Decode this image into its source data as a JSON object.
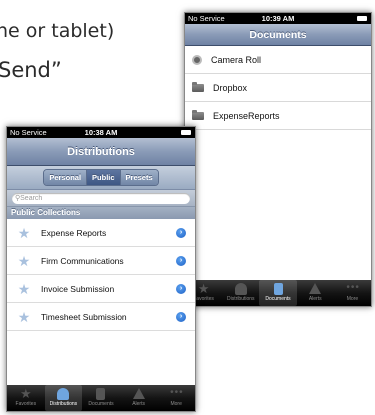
{
  "doc": {
    "line1": "ne or tablet)",
    "line2": "Send”"
  },
  "documents_screen": {
    "status": {
      "carrier": "No Service",
      "time": "10:39 AM"
    },
    "title": "Documents",
    "items": [
      {
        "label": "Camera Roll",
        "icon": "camera-icon"
      },
      {
        "label": "Dropbox",
        "icon": "folder-icon"
      },
      {
        "label": "ExpenseReports",
        "icon": "folder-icon"
      }
    ],
    "tabs": [
      {
        "label": "Favorites",
        "icon": "star-icon"
      },
      {
        "label": "Distributions",
        "icon": "people-icon"
      },
      {
        "label": "Documents",
        "icon": "documents-icon",
        "active": true
      },
      {
        "label": "Alerts",
        "icon": "alert-icon"
      },
      {
        "label": "More",
        "icon": "more-icon"
      }
    ]
  },
  "distributions_screen": {
    "status": {
      "carrier": "No Service",
      "time": "10:38 AM"
    },
    "title": "Distributions",
    "segments": [
      {
        "label": "Personal"
      },
      {
        "label": "Public",
        "active": true
      },
      {
        "label": "Presets"
      }
    ],
    "search_placeholder": "Search",
    "section_header": "Public Collections",
    "items": [
      {
        "label": "Expense Reports"
      },
      {
        "label": "Firm Communications"
      },
      {
        "label": "Invoice Submission"
      },
      {
        "label": "Timesheet Submission"
      }
    ],
    "tabs": [
      {
        "label": "Favorites",
        "icon": "star-icon"
      },
      {
        "label": "Distributions",
        "icon": "people-icon",
        "active": true
      },
      {
        "label": "Documents",
        "icon": "documents-icon"
      },
      {
        "label": "Alerts",
        "icon": "alert-icon"
      },
      {
        "label": "More",
        "icon": "more-icon"
      }
    ]
  },
  "colors": {
    "navbar": "#8a9bb7",
    "active_tab_icon": "#6fa5df",
    "disclosure": "#1f62c6"
  }
}
